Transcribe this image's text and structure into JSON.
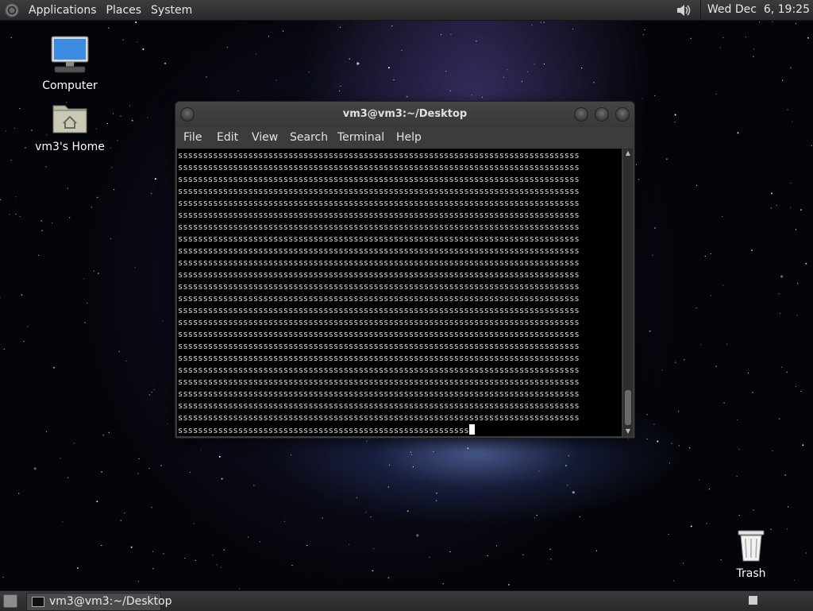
{
  "top_panel": {
    "menus": [
      "Applications",
      "Places",
      "System"
    ],
    "clock": "Wed Dec  6, 19:25"
  },
  "desktop": {
    "icons": [
      {
        "label": "Computer",
        "icon": "computer-icon"
      },
      {
        "label": "vm3's Home",
        "icon": "home-folder-icon"
      },
      {
        "label": "Trash",
        "icon": "trash-icon"
      }
    ]
  },
  "terminal": {
    "title": "vm3@vm3:~/Desktop",
    "menu": [
      "File",
      "Edit",
      "View",
      "Search",
      "Terminal",
      "Help"
    ],
    "full_line": "ssssssssssssssssssssssssssssssssssssssssssssssssssssssssssssssssssssssssssssssss",
    "full_line_count": 23,
    "last_line": "ssssssssssssssssssssssssssssssssssssssssssssssssssssssssss"
  },
  "taskbar": {
    "window_label": "vm3@vm3:~/Desktop"
  },
  "colors": {
    "panel": "#333333",
    "terminal_bg": "#000000",
    "terminal_fg": "#d8d8d8"
  }
}
